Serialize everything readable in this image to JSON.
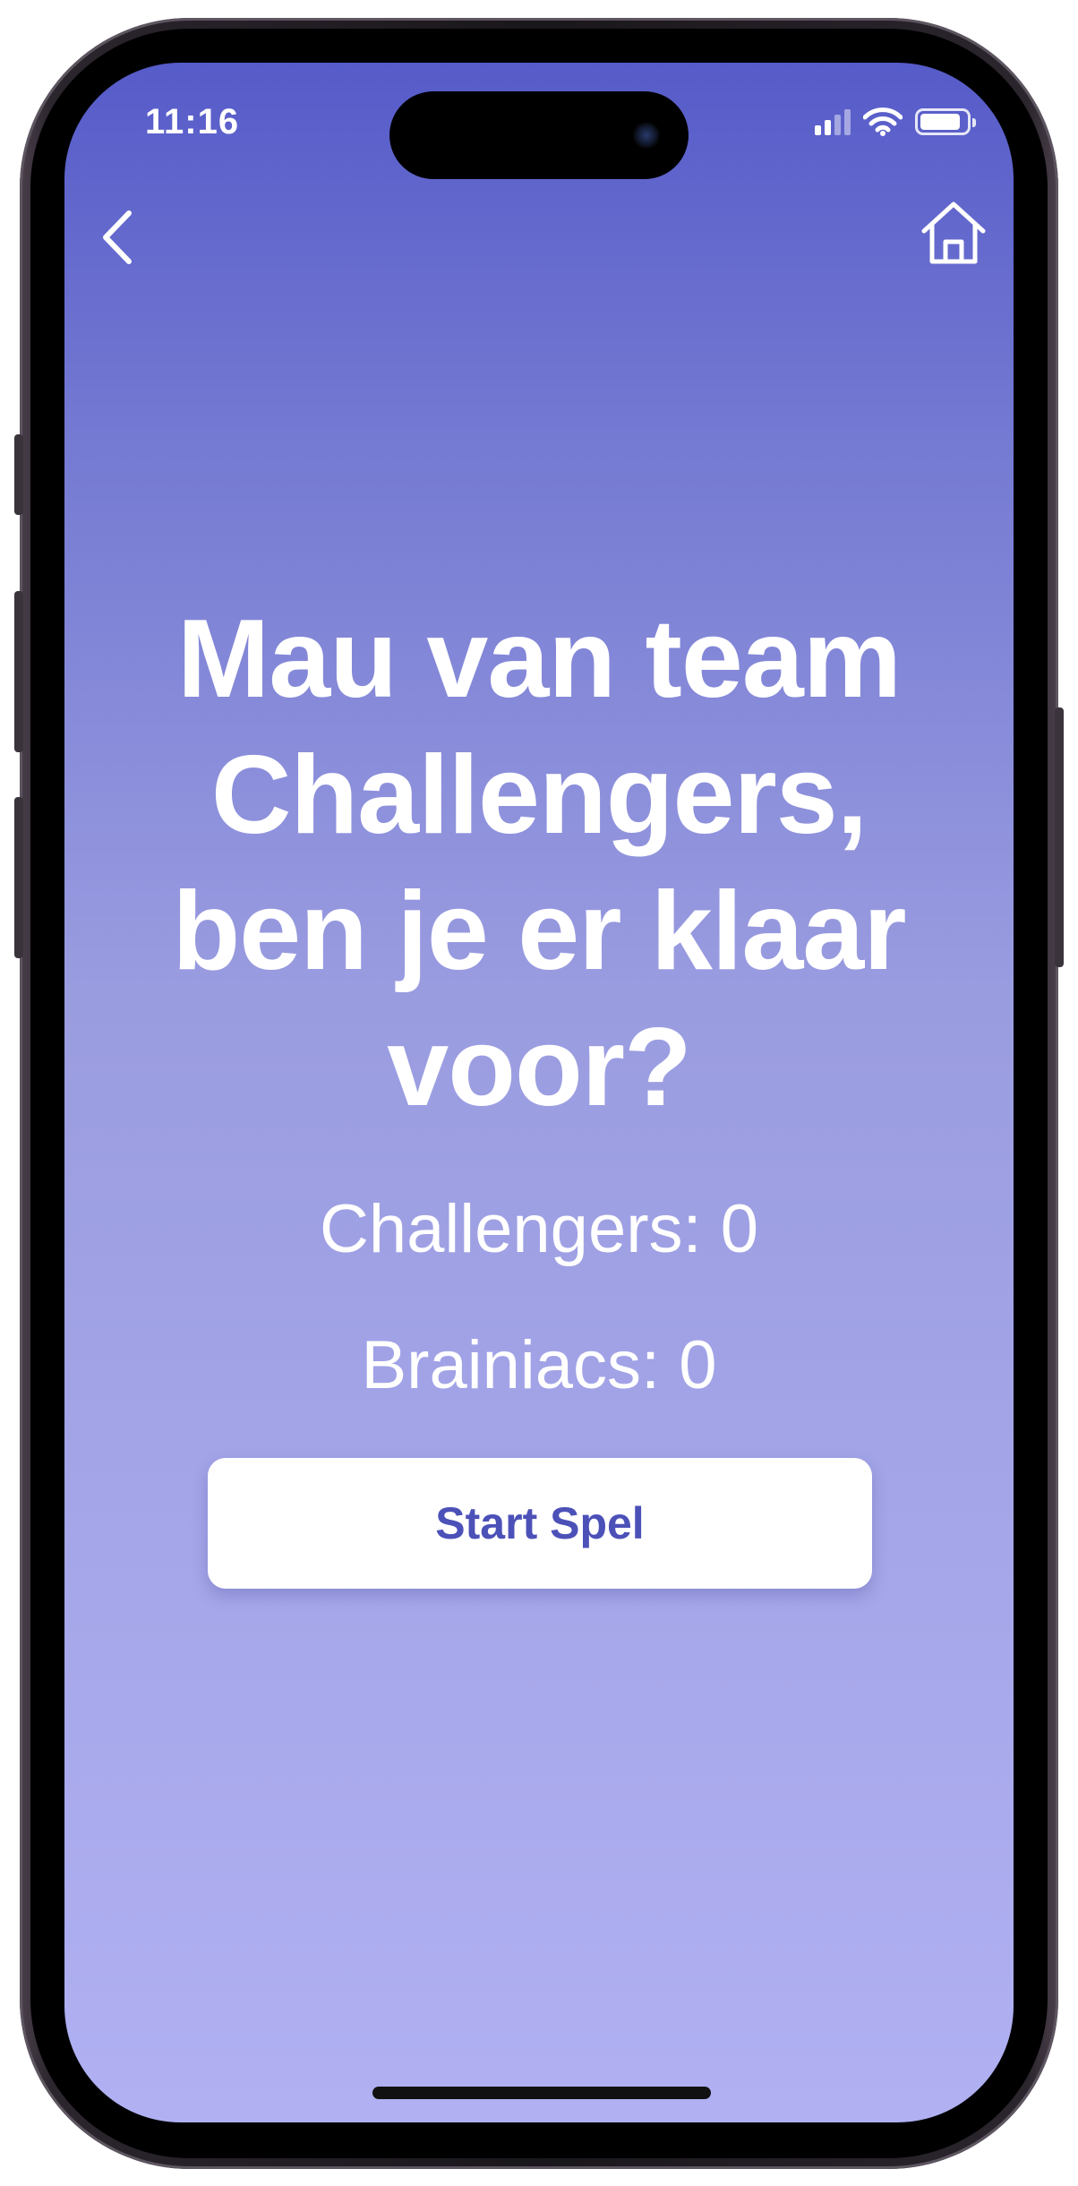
{
  "status_bar": {
    "time": "11:16"
  },
  "nav": {
    "back_icon": "chevron-left-icon",
    "home_icon": "home-icon"
  },
  "main": {
    "headline": "Mau van team Challengers, ben je er klaar voor?",
    "scores": [
      {
        "text": "Challengers: 0"
      },
      {
        "text": "Brainiacs: 0"
      }
    ],
    "start_button_label": "Start Spel"
  },
  "colors": {
    "gradient_top": "#565bc9",
    "gradient_bottom": "#b0b0f3",
    "button_text": "#4c51b8",
    "button_background": "#ffffff"
  }
}
